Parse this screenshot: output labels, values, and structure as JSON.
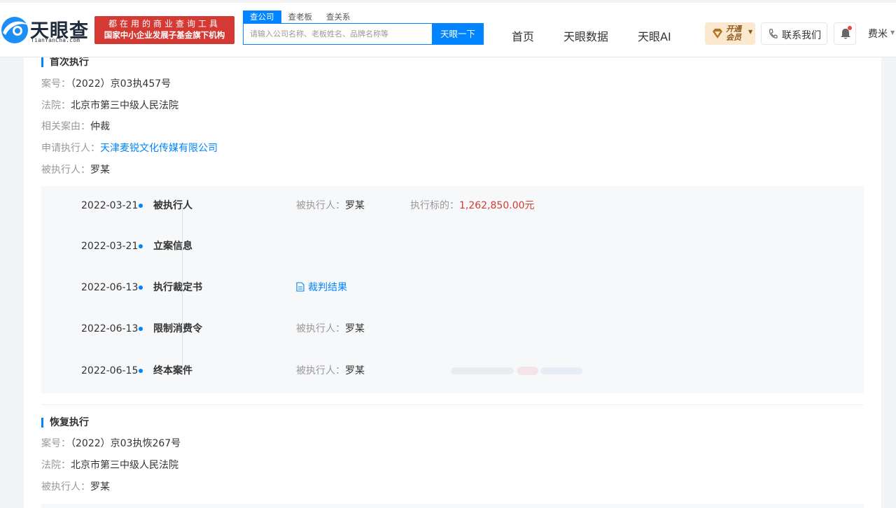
{
  "header": {
    "logo_text": "天眼查",
    "logo_sub": "TianYanCha.com",
    "banner_line1": "都在用的商业查询工具",
    "banner_line2": "国家中小企业发展子基金旗下机构",
    "search_tabs": [
      "查公司",
      "查老板",
      "查关系"
    ],
    "search_placeholder": "请输入公司名称、老板姓名、品牌名称等",
    "search_button": "天眼一下",
    "nav": [
      "首页",
      "天眼数据",
      "天眼AI"
    ],
    "vip_label": "开通会员",
    "contact_label": "联系我们",
    "user_name": "费米"
  },
  "first_execution": {
    "title": "首次执行",
    "case_no_label": "案号：",
    "case_no": "（2022）京03执457号",
    "court_label": "法院：",
    "court": "北京市第三中级人民法院",
    "cause_label": "相关案由：",
    "cause": "仲裁",
    "applicant_label": "申请执行人：",
    "applicant": "天津麦锐文化传媒有限公司",
    "respondent_label": "被执行人：",
    "respondent": "罗某"
  },
  "timeline": [
    {
      "date": "2022-03-21",
      "type": "被执行人",
      "f1_label": "被执行人：",
      "f1_value": "罗某",
      "f2_label": "执行标的：",
      "f2_value": "1,262,850.00元"
    },
    {
      "date": "2022-03-21",
      "type": "立案信息"
    },
    {
      "date": "2022-06-13",
      "type": "执行裁定书",
      "link": "裁判结果"
    },
    {
      "date": "2022-06-13",
      "type": "限制消费令",
      "f1_label": "被执行人：",
      "f1_value": "罗某"
    },
    {
      "date": "2022-06-15",
      "type": "终本案件",
      "f1_label": "被执行人：",
      "f1_value": "罗某"
    }
  ],
  "resumed_execution": {
    "title": "恢复执行",
    "case_no_label": "案号：",
    "case_no": "（2022）京03执恢267号",
    "court_label": "法院：",
    "court": "北京市第三中级人民法院",
    "respondent_label": "被执行人：",
    "respondent": "罗某"
  },
  "colors": {
    "accent": "#0084ff",
    "brand_red": "#d43a33",
    "amount_red": "#d43a33",
    "timeline_bg": "#f7f8fa"
  },
  "icons": [
    "logo-eye-icon",
    "diamond-icon",
    "phone-icon",
    "bell-icon",
    "document-icon"
  ]
}
